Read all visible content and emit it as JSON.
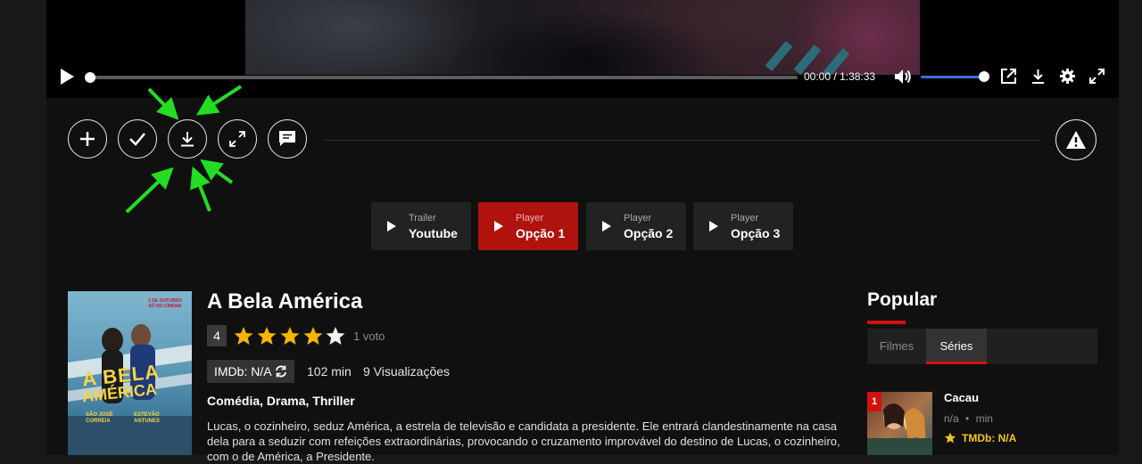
{
  "player": {
    "current_time": "00:00",
    "separator": "/",
    "duration": "1:38:33",
    "progress": 0,
    "volume": 1.0
  },
  "actions": {
    "icons": [
      "plus-icon",
      "check-icon",
      "download-icon",
      "fullscreen-icon",
      "comment-icon",
      "warning-icon"
    ]
  },
  "servers": [
    {
      "small": "Trailer",
      "big": "Youtube",
      "active": false
    },
    {
      "small": "Player",
      "big": "Opção 1",
      "active": true
    },
    {
      "small": "Player",
      "big": "Opção 2",
      "active": false
    },
    {
      "small": "Player",
      "big": "Opção 3",
      "active": false
    }
  ],
  "movie": {
    "title": "A Bela América",
    "rating": "4",
    "stars": 5,
    "votes": "1 voto",
    "imdb": "IMDb: N/A",
    "runtime": "102 min",
    "views": "9 Visualizações",
    "genres": "Comédia, Drama, Thriller",
    "synopsis": "Lucas, o cozinheiro, seduz América, a estrela de televisão e candidata a presidente. Ele entrará clandestinamente na casa dela para a seduzir com refeições extraordinárias, provocando o cruzamento improvável do destino de Lucas, o cozinheiro, com o de América, a Presidente.",
    "poster": {
      "top_text": "2 DE OUTUBRO\nSÓ NO CINEMA",
      "title_line1": "A BELA",
      "title_line2": "AMÉRICA",
      "actor1": "SÃO JOSÉ\nCORREIA",
      "actor2": "ESTEVÃO\nANTUNES"
    }
  },
  "popular": {
    "title": "Popular",
    "tabs": [
      "Filmes",
      "Séries"
    ],
    "active_tab": "Séries",
    "items": [
      {
        "rank": "1",
        "title": "Cacau",
        "meta_left": "n/a",
        "meta_right": "min",
        "tmdb": "TMDb: N/A"
      }
    ]
  },
  "colors": {
    "accent": "#b0120e",
    "annotation_arrows": "#22dd22",
    "volume": "#3d6ee0",
    "star": "#f5b400"
  }
}
